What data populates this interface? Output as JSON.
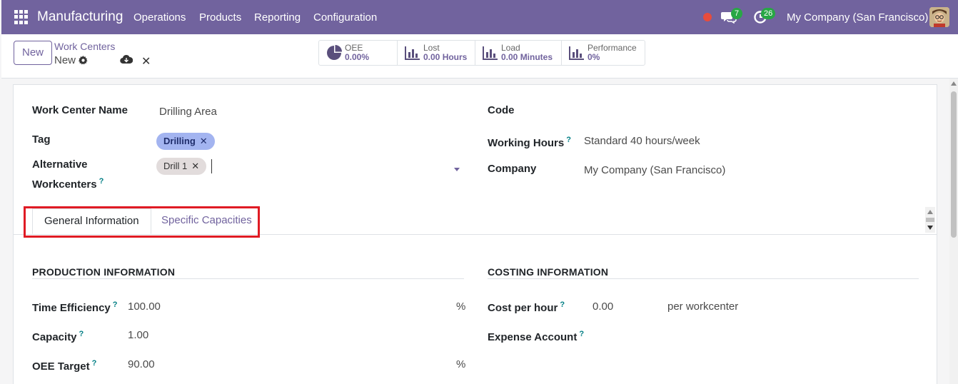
{
  "navbar": {
    "brand": "Manufacturing",
    "menu": [
      "Operations",
      "Products",
      "Reporting",
      "Configuration"
    ],
    "messages_count": "7",
    "activities_count": "26",
    "company": "My Company (San Francisco)",
    "colors": {
      "bar": "#71639e",
      "badge": "#28a745",
      "record": "#e74c3c"
    }
  },
  "control": {
    "new_label": "New",
    "breadcrumb_parent": "Work Centers",
    "breadcrumb_current": "New",
    "stats": [
      {
        "label": "OEE",
        "value": "0.00%",
        "icon": "pie-chart-icon"
      },
      {
        "label": "Lost",
        "value": "0.00 Hours",
        "icon": "bar-chart-icon"
      },
      {
        "label": "Load",
        "value": "0.00 Minutes",
        "icon": "bar-chart-icon"
      },
      {
        "label": "Performance",
        "value": "0%",
        "icon": "bar-chart-icon"
      }
    ]
  },
  "form": {
    "name_label": "Work Center Name",
    "name_value": "Drilling Area",
    "tag_label": "Tag",
    "tag_value": "Drilling",
    "alt_label_1": "Alternative",
    "alt_label_2": "Workcenters",
    "alt_value": "Drill 1",
    "code_label": "Code",
    "hours_label": "Working Hours",
    "hours_value": "Standard 40 hours/week",
    "company_label": "Company",
    "company_value": "My Company (San Francisco)",
    "help_mark": "?"
  },
  "tabs": {
    "general": "General Information",
    "capacities": "Specific Capacities"
  },
  "production": {
    "title": "PRODUCTION INFORMATION",
    "efficiency_label": "Time Efficiency",
    "efficiency_value": "100.00",
    "capacity_label": "Capacity",
    "capacity_value": "1.00",
    "oee_label": "OEE Target",
    "oee_value": "90.00",
    "percent": "%"
  },
  "costing": {
    "title": "COSTING INFORMATION",
    "cost_label": "Cost per hour",
    "cost_value": "0.00",
    "cost_unit": "per workcenter",
    "expense_label": "Expense Account"
  }
}
